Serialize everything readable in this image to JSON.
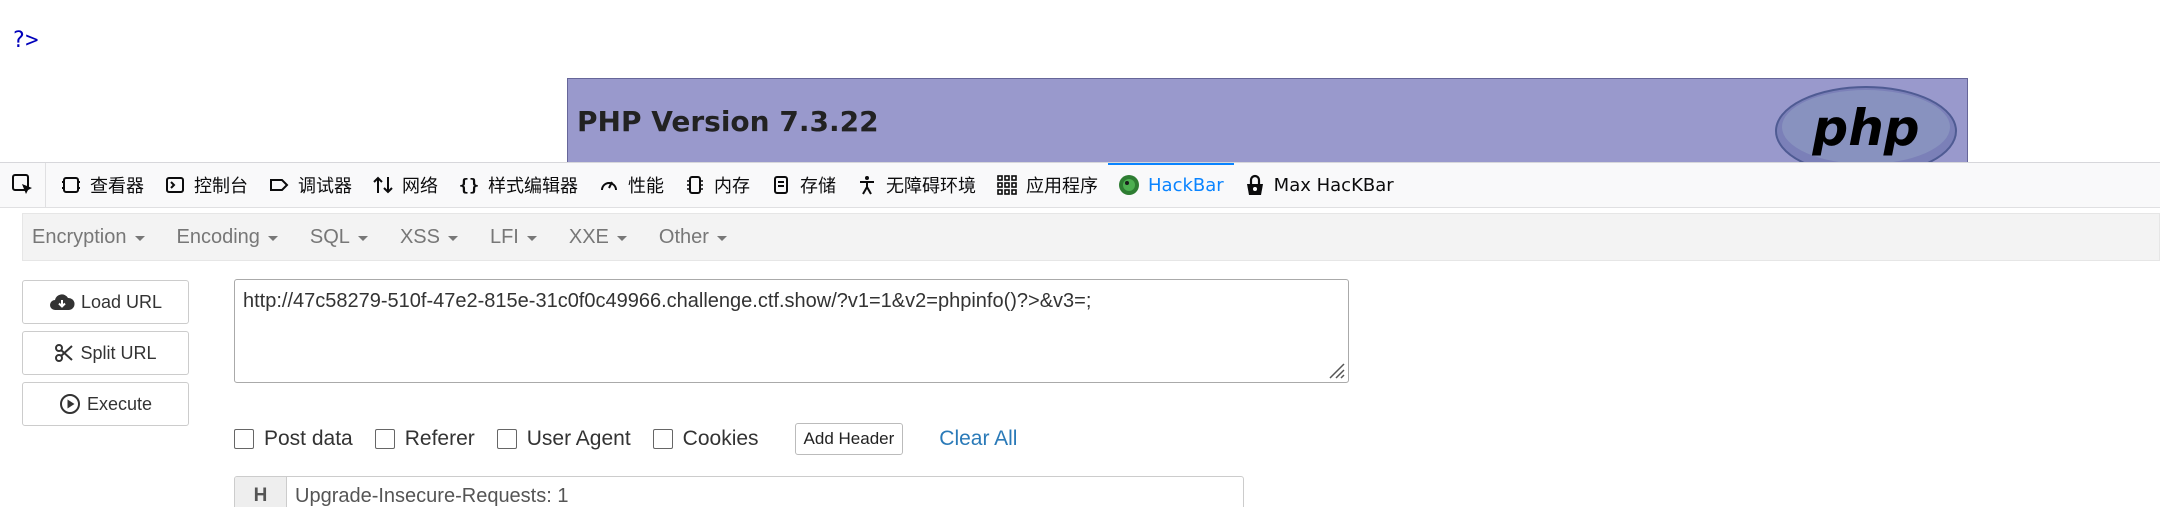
{
  "page": {
    "php_tail": "?>",
    "php_version": "PHP Version 7.3.22",
    "logo_text": "php"
  },
  "devtools": {
    "tabs": [
      {
        "label": "查看器",
        "icon": "inspector-icon"
      },
      {
        "label": "控制台",
        "icon": "console-icon"
      },
      {
        "label": "调试器",
        "icon": "debugger-icon"
      },
      {
        "label": "网络",
        "icon": "network-icon"
      },
      {
        "label": "样式编辑器",
        "icon": "style-editor-icon"
      },
      {
        "label": "性能",
        "icon": "performance-icon"
      },
      {
        "label": "内存",
        "icon": "memory-icon"
      },
      {
        "label": "存储",
        "icon": "storage-icon"
      },
      {
        "label": "无障碍环境",
        "icon": "accessibility-icon"
      },
      {
        "label": "应用程序",
        "icon": "application-icon"
      },
      {
        "label": "HackBar",
        "icon": "hackbar-icon",
        "active": true
      },
      {
        "label": "Max HacKBar",
        "icon": "max-hackbar-icon"
      }
    ],
    "accent": "#0a84ff"
  },
  "hackbar": {
    "menu": [
      "Encryption",
      "Encoding",
      "SQL",
      "XSS",
      "LFI",
      "XXE",
      "Other"
    ],
    "buttons": {
      "load": "Load URL",
      "split": "Split URL",
      "execute": "Execute"
    },
    "url": "http://47c58279-510f-47e2-815e-31c0f0c49966.challenge.ctf.show/?v1=1&v2=phpinfo()?>&v3=;",
    "options": {
      "post_data": "Post data",
      "referer": "Referer",
      "user_agent": "User Agent",
      "cookies": "Cookies"
    },
    "add_header": "Add Header",
    "clear_all": "Clear All",
    "header_tag": "H",
    "header_value": "Upgrade-Insecure-Requests: 1",
    "link_color": "#2a7ab8"
  }
}
